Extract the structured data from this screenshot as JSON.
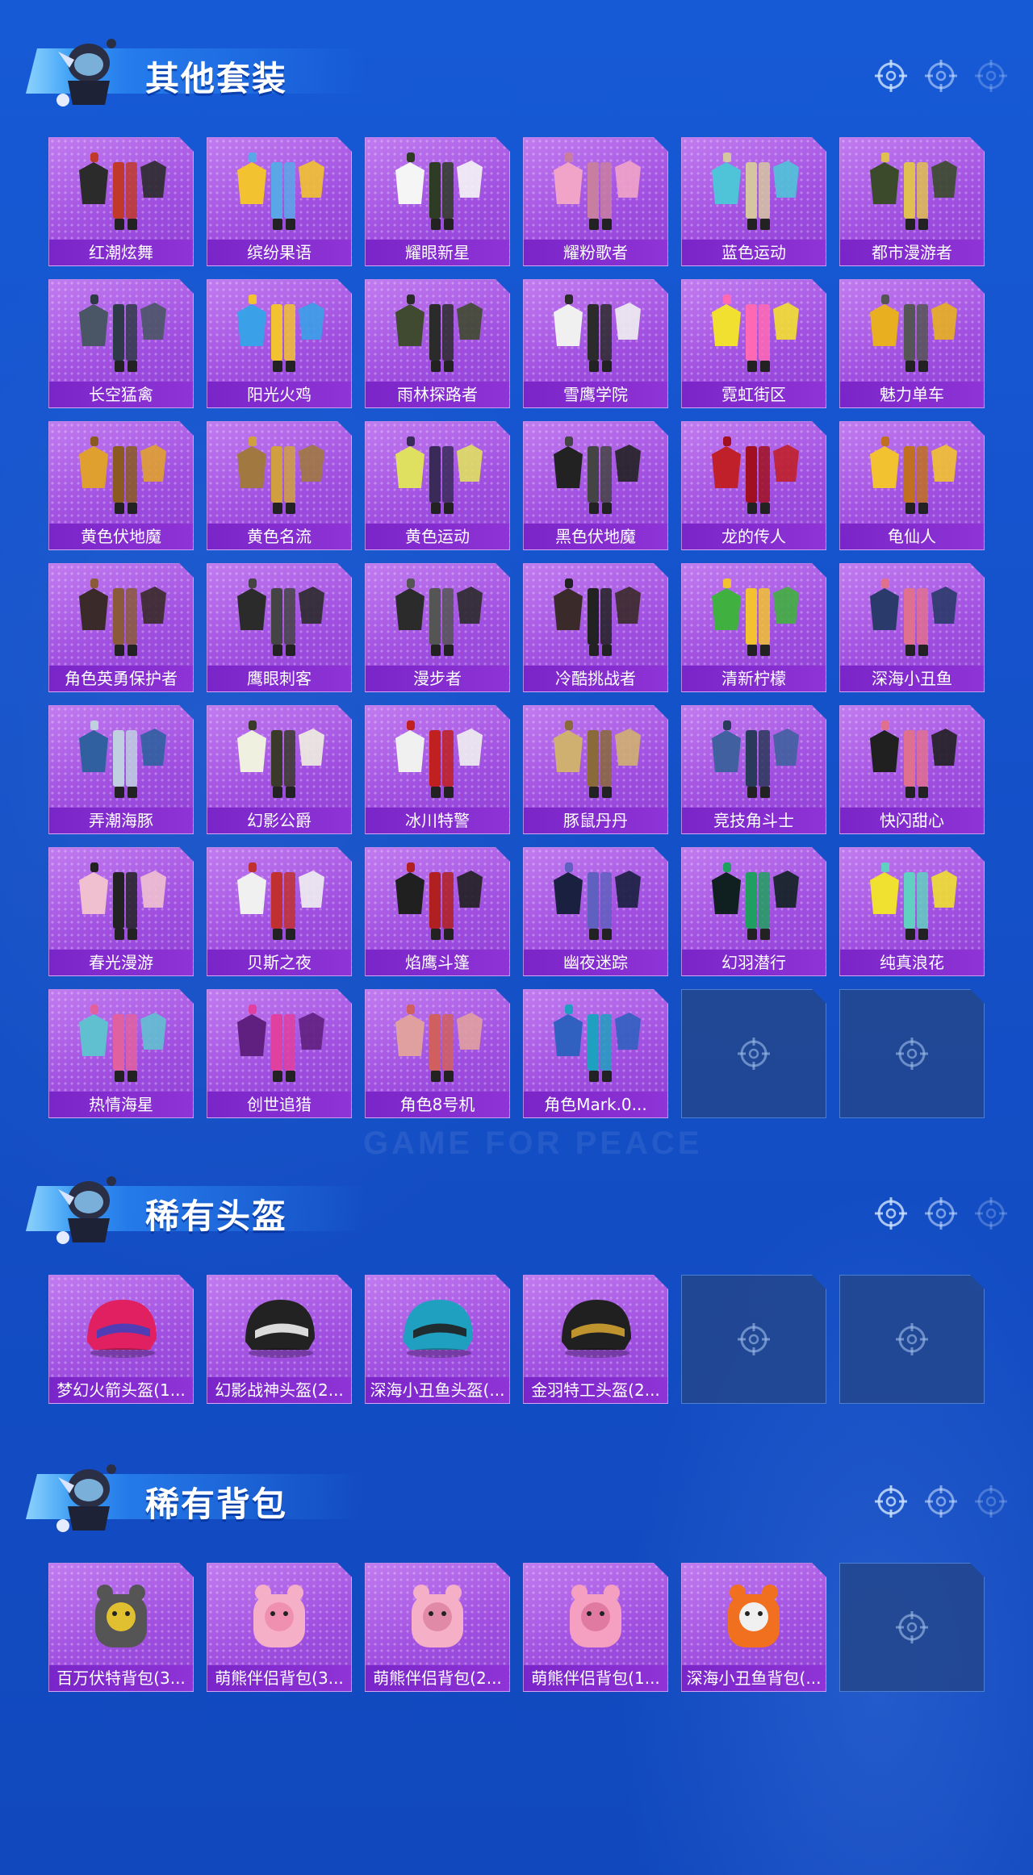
{
  "sections": [
    {
      "title": "其他套装",
      "items": [
        {
          "label": "红潮炫舞"
        },
        {
          "label": "缤纷果语"
        },
        {
          "label": "耀眼新星"
        },
        {
          "label": "耀粉歌者"
        },
        {
          "label": "蓝色运动"
        },
        {
          "label": "都市漫游者"
        },
        {
          "label": "长空猛禽"
        },
        {
          "label": "阳光火鸡"
        },
        {
          "label": "雨林探路者"
        },
        {
          "label": "雪鹰学院"
        },
        {
          "label": "霓虹街区"
        },
        {
          "label": "魅力单车"
        },
        {
          "label": "黄色伏地魔"
        },
        {
          "label": "黄色名流"
        },
        {
          "label": "黄色运动"
        },
        {
          "label": "黑色伏地魔"
        },
        {
          "label": "龙的传人"
        },
        {
          "label": "龟仙人"
        },
        {
          "label": "角色英勇保护者"
        },
        {
          "label": "鹰眼刺客"
        },
        {
          "label": "漫步者"
        },
        {
          "label": "冷酷挑战者"
        },
        {
          "label": "清新柠檬"
        },
        {
          "label": "深海小丑鱼"
        },
        {
          "label": "弄潮海豚"
        },
        {
          "label": "幻影公爵"
        },
        {
          "label": "冰川特警"
        },
        {
          "label": "豚鼠丹丹"
        },
        {
          "label": "竞技角斗士"
        },
        {
          "label": "快闪甜心"
        },
        {
          "label": "春光漫游"
        },
        {
          "label": "贝斯之夜"
        },
        {
          "label": "焰鹰斗篷"
        },
        {
          "label": "幽夜迷踪"
        },
        {
          "label": "幻羽潜行"
        },
        {
          "label": "纯真浪花"
        },
        {
          "label": "热情海星"
        },
        {
          "label": "创世追猎"
        },
        {
          "label": "角色8号机"
        },
        {
          "label": "角色Mark.0..."
        }
      ],
      "empty_slots": 2
    },
    {
      "title": "稀有头盔",
      "items": [
        {
          "label": "梦幻火箭头盔(1..."
        },
        {
          "label": "幻影战神头盔(2..."
        },
        {
          "label": "深海小丑鱼头盔(..."
        },
        {
          "label": "金羽特工头盔(2..."
        }
      ],
      "empty_slots": 2
    },
    {
      "title": "稀有背包",
      "items": [
        {
          "label": "百万伏特背包(3..."
        },
        {
          "label": "萌熊伴侣背包(3..."
        },
        {
          "label": "萌熊伴侣背包(2..."
        },
        {
          "label": "萌熊伴侣背包(1..."
        },
        {
          "label": "深海小丑鱼背包(..."
        }
      ],
      "empty_slots": 1
    }
  ],
  "watermark": "GAME FOR PEACE",
  "icons": {
    "section_header": "crosshair-icon",
    "empty_slot": "crosshair-icon",
    "mascot": "mascot-icon"
  },
  "colors": {
    "background": "#1452c9",
    "card": "#a85ae0",
    "card_label": "#7a25c9",
    "empty_card": "#23468c"
  }
}
